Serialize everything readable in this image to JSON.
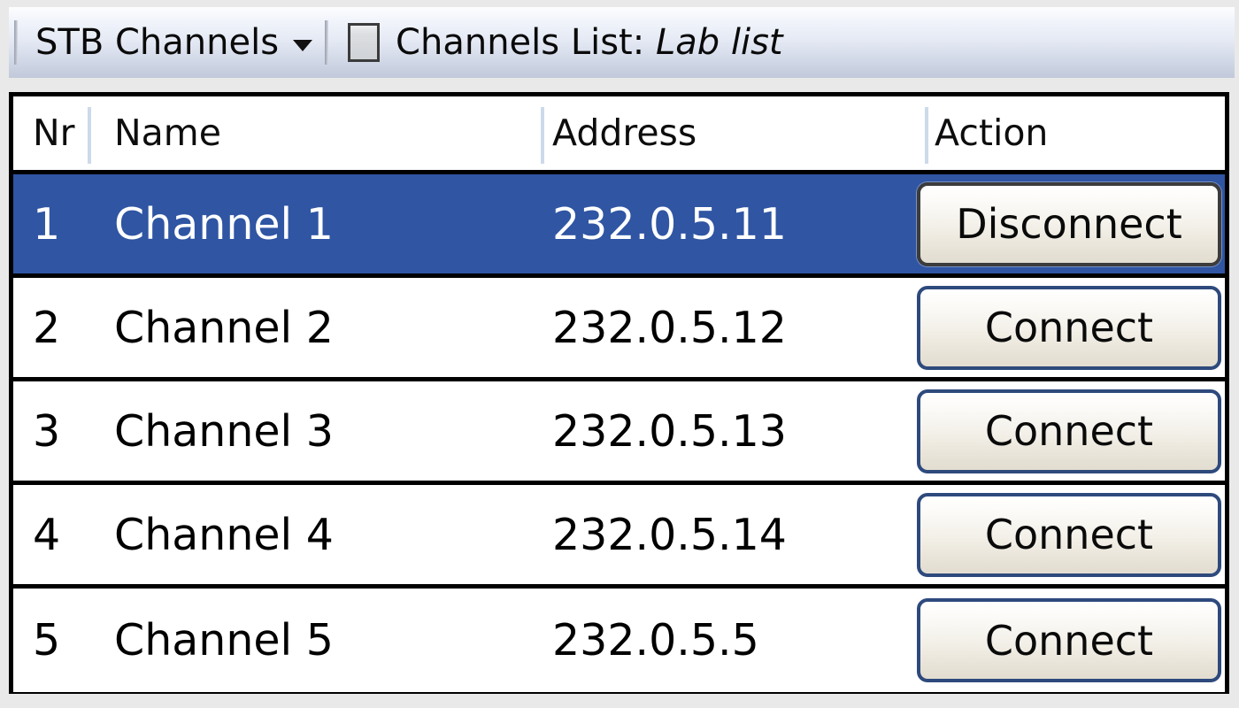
{
  "toolbar": {
    "menu_label": "STB Channels",
    "caret_icon": "chevron-down-icon",
    "list_icon": "list-box-icon",
    "channels_list_prefix": "Channels List:",
    "channels_list_value": "Lab list"
  },
  "table": {
    "columns": [
      "Nr",
      "Name",
      "Address",
      "Action"
    ],
    "rows": [
      {
        "nr": "1",
        "name": "Channel 1",
        "address": "232.0.5.11",
        "action": "Disconnect",
        "selected": true
      },
      {
        "nr": "2",
        "name": "Channel 2",
        "address": "232.0.5.12",
        "action": "Connect",
        "selected": false
      },
      {
        "nr": "3",
        "name": "Channel 3",
        "address": "232.0.5.13",
        "action": "Connect",
        "selected": false
      },
      {
        "nr": "4",
        "name": "Channel 4",
        "address": "232.0.5.14",
        "action": "Connect",
        "selected": false
      },
      {
        "nr": "5",
        "name": "Channel 5",
        "address": "232.0.5.5",
        "action": "Connect",
        "selected": false
      }
    ]
  },
  "colors": {
    "selection_blue": "#2f55a3",
    "button_border": "#2e4a7d",
    "toolbar_top": "#fcfdff",
    "toolbar_bottom": "#c1c9da",
    "header_separator": "#ccdaea",
    "page_background": "#e9e9e9"
  }
}
